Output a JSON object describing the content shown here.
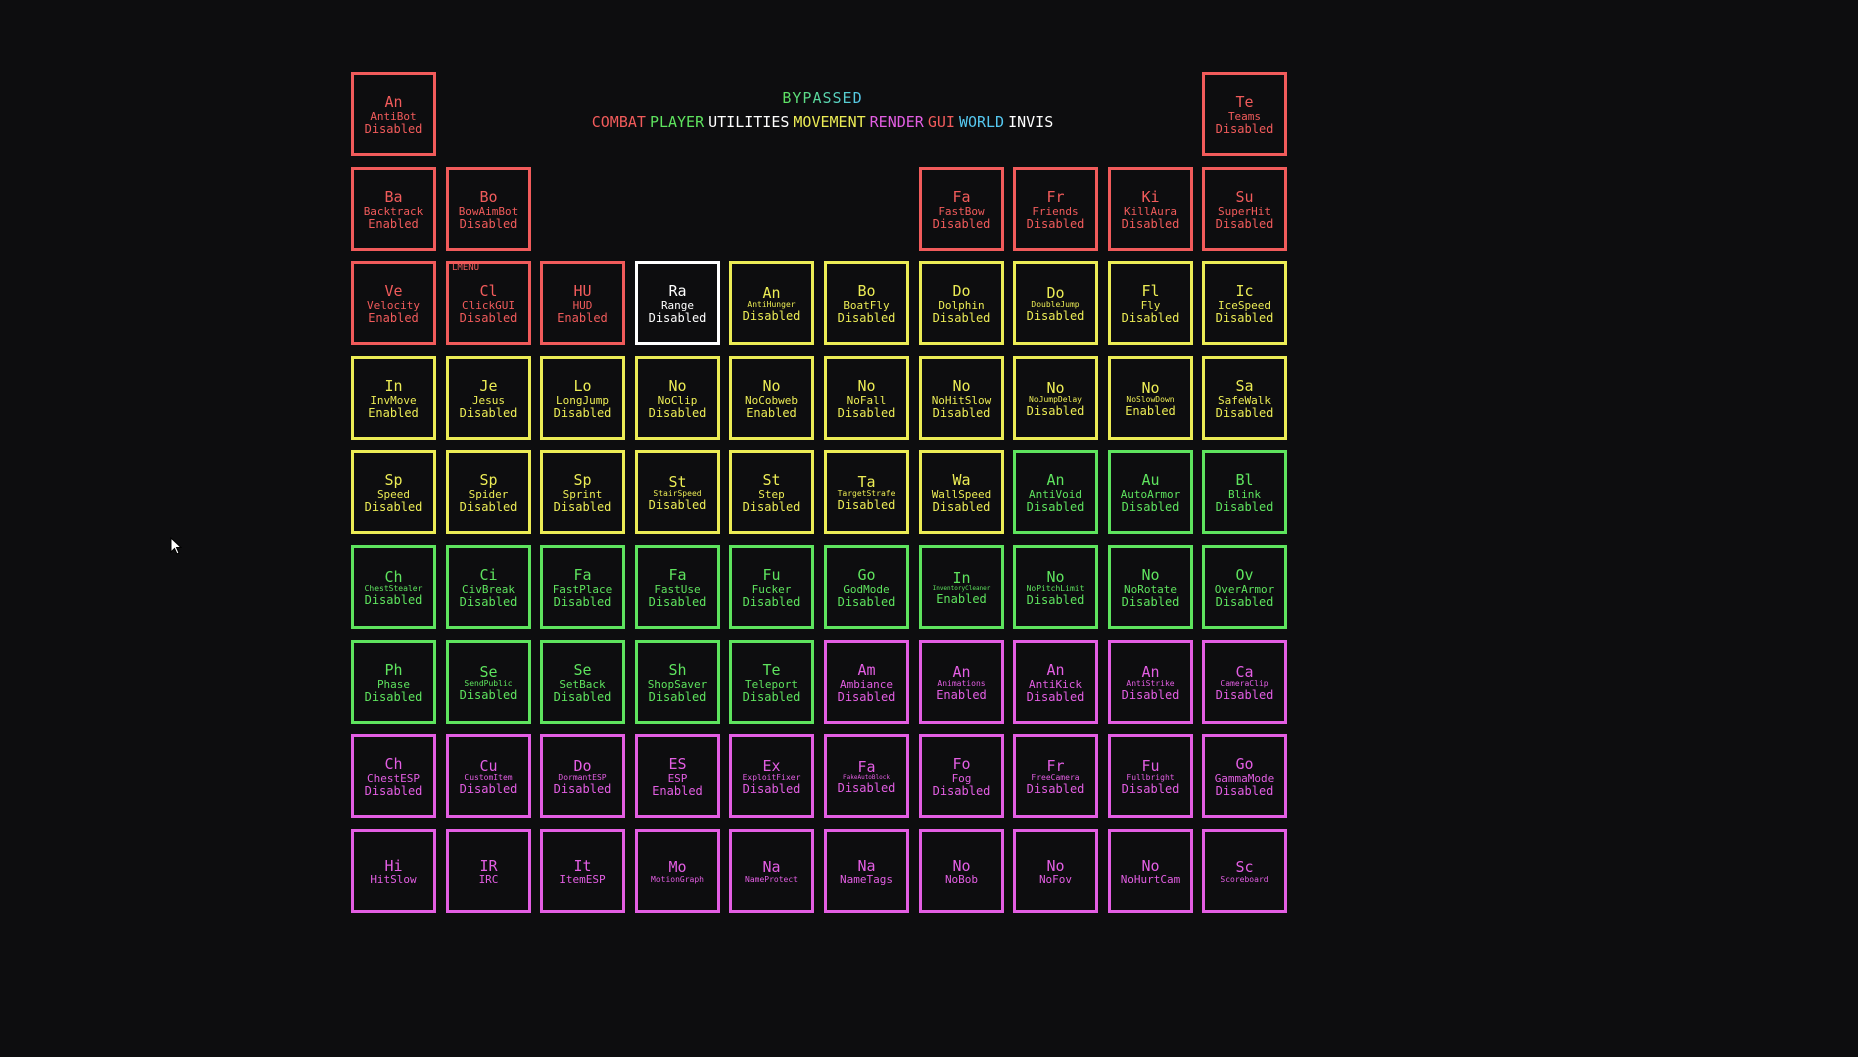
{
  "colors": {
    "combat": "#f15b5b",
    "player": "#5ee35e",
    "utilities": "#ffffff",
    "movement": "#ecec55",
    "render": "#e35ee3",
    "gui": "#f15b5b",
    "world": "#55c8f0",
    "invis": "#ffffff",
    "selected": "#ffffff",
    "bypassed_gradient": [
      "#5ee35e",
      "#55c8f0"
    ]
  },
  "header": {
    "bypassed": "BYPASSED",
    "tabs": [
      {
        "label": "COMBAT",
        "color": "#f15b5b"
      },
      {
        "label": "PLAYER",
        "color": "#5ee35e"
      },
      {
        "label": "UTILITIES",
        "color": "#ffffff"
      },
      {
        "label": "MOVEMENT",
        "color": "#ecec55"
      },
      {
        "label": "RENDER",
        "color": "#e35ee3"
      },
      {
        "label": "GUI",
        "color": "#f15b5b"
      },
      {
        "label": "WORLD",
        "color": "#55c8f0"
      },
      {
        "label": "INVIS",
        "color": "#ffffff"
      }
    ]
  },
  "modules": [
    [
      [
        "An",
        "AntiBot",
        "Disabled",
        "combat"
      ],
      null,
      null,
      null,
      null,
      null,
      null,
      null,
      null,
      [
        "Te",
        "Teams",
        "Disabled",
        "combat"
      ]
    ],
    [
      [
        "Ba",
        "Backtrack",
        "Enabled",
        "combat"
      ],
      [
        "Bo",
        "BowAimBot",
        "Disabled",
        "combat"
      ],
      null,
      null,
      null,
      null,
      [
        "Fa",
        "FastBow",
        "Disabled",
        "combat"
      ],
      [
        "Fr",
        "Friends",
        "Disabled",
        "combat"
      ],
      [
        "Ki",
        "KillAura",
        "Disabled",
        "combat"
      ],
      [
        "Su",
        "SuperHit",
        "Disabled",
        "combat"
      ]
    ],
    [
      [
        "Ve",
        "Velocity",
        "Enabled",
        "combat"
      ],
      [
        "Cl",
        "ClickGUI",
        "Disabled",
        "combat",
        "LMENU"
      ],
      [
        "HU",
        "HUD",
        "Enabled",
        "combat"
      ],
      [
        "Ra",
        "Range",
        "Disabled",
        "selected"
      ],
      [
        "An",
        "AntiHunger",
        "Disabled",
        "movement"
      ],
      [
        "Bo",
        "BoatFly",
        "Disabled",
        "movement"
      ],
      [
        "Do",
        "Dolphin",
        "Disabled",
        "movement"
      ],
      [
        "Do",
        "DoubleJump",
        "Disabled",
        "movement"
      ],
      [
        "Fl",
        "Fly",
        "Disabled",
        "movement"
      ],
      [
        "Ic",
        "IceSpeed",
        "Disabled",
        "movement"
      ]
    ],
    [
      [
        "In",
        "InvMove",
        "Enabled",
        "movement"
      ],
      [
        "Je",
        "Jesus",
        "Disabled",
        "movement"
      ],
      [
        "Lo",
        "LongJump",
        "Disabled",
        "movement"
      ],
      [
        "No",
        "NoClip",
        "Disabled",
        "movement"
      ],
      [
        "No",
        "NoCobweb",
        "Enabled",
        "movement"
      ],
      [
        "No",
        "NoFall",
        "Disabled",
        "movement"
      ],
      [
        "No",
        "NoHitSlow",
        "Disabled",
        "movement"
      ],
      [
        "No",
        "NoJumpDelay",
        "Disabled",
        "movement"
      ],
      [
        "No",
        "NoSlowDown",
        "Enabled",
        "movement"
      ],
      [
        "Sa",
        "SafeWalk",
        "Disabled",
        "movement"
      ]
    ],
    [
      [
        "Sp",
        "Speed",
        "Disabled",
        "movement"
      ],
      [
        "Sp",
        "Spider",
        "Disabled",
        "movement"
      ],
      [
        "Sp",
        "Sprint",
        "Disabled",
        "movement"
      ],
      [
        "St",
        "StairSpeed",
        "Disabled",
        "movement"
      ],
      [
        "St",
        "Step",
        "Disabled",
        "movement"
      ],
      [
        "Ta",
        "TargetStrafe",
        "Disabled",
        "movement"
      ],
      [
        "Wa",
        "WallSpeed",
        "Disabled",
        "movement"
      ],
      [
        "An",
        "AntiVoid",
        "Disabled",
        "player"
      ],
      [
        "Au",
        "AutoArmor",
        "Disabled",
        "player"
      ],
      [
        "Bl",
        "Blink",
        "Disabled",
        "player"
      ]
    ],
    [
      [
        "Ch",
        "ChestStealer",
        "Disabled",
        "player"
      ],
      [
        "Ci",
        "CivBreak",
        "Disabled",
        "player"
      ],
      [
        "Fa",
        "FastPlace",
        "Disabled",
        "player"
      ],
      [
        "Fa",
        "FastUse",
        "Disabled",
        "player"
      ],
      [
        "Fu",
        "Fucker",
        "Disabled",
        "player"
      ],
      [
        "Go",
        "GodMode",
        "Disabled",
        "player"
      ],
      [
        "In",
        "InventoryCleaner",
        "Enabled",
        "player"
      ],
      [
        "No",
        "NoPitchLimit",
        "Disabled",
        "player"
      ],
      [
        "No",
        "NoRotate",
        "Disabled",
        "player"
      ],
      [
        "Ov",
        "OverArmor",
        "Disabled",
        "player"
      ]
    ],
    [
      [
        "Ph",
        "Phase",
        "Disabled",
        "player"
      ],
      [
        "Se",
        "SendPublic",
        "Disabled",
        "player"
      ],
      [
        "Se",
        "SetBack",
        "Disabled",
        "player"
      ],
      [
        "Sh",
        "ShopSaver",
        "Disabled",
        "player"
      ],
      [
        "Te",
        "Teleport",
        "Disabled",
        "player"
      ],
      [
        "Am",
        "Ambiance",
        "Disabled",
        "render"
      ],
      [
        "An",
        "Animations",
        "Enabled",
        "render"
      ],
      [
        "An",
        "AntiKick",
        "Disabled",
        "render"
      ],
      [
        "An",
        "AntiStrike",
        "Disabled",
        "render"
      ],
      [
        "Ca",
        "CameraClip",
        "Disabled",
        "render"
      ]
    ],
    [
      [
        "Ch",
        "ChestESP",
        "Disabled",
        "render"
      ],
      [
        "Cu",
        "CustomItem",
        "Disabled",
        "render"
      ],
      [
        "Do",
        "DormantESP",
        "Disabled",
        "render"
      ],
      [
        "ES",
        "ESP",
        "Enabled",
        "render"
      ],
      [
        "Ex",
        "ExploitFixer",
        "Disabled",
        "render"
      ],
      [
        "Fa",
        "FakeAutoBlock",
        "Disabled",
        "render"
      ],
      [
        "Fo",
        "Fog",
        "Disabled",
        "render"
      ],
      [
        "Fr",
        "FreeCamera",
        "Disabled",
        "render"
      ],
      [
        "Fu",
        "Fullbright",
        "Disabled",
        "render"
      ],
      [
        "Go",
        "GammaMode",
        "Disabled",
        "render"
      ]
    ],
    [
      [
        "Hi",
        "HitSlow",
        "",
        "render"
      ],
      [
        "IR",
        "IRC",
        "",
        "render"
      ],
      [
        "It",
        "ItemESP",
        "",
        "render"
      ],
      [
        "Mo",
        "MotionGraph",
        "",
        "render"
      ],
      [
        "Na",
        "NameProtect",
        "",
        "render"
      ],
      [
        "Na",
        "NameTags",
        "",
        "render"
      ],
      [
        "No",
        "NoBob",
        "",
        "render"
      ],
      [
        "No",
        "NoFov",
        "",
        "render"
      ],
      [
        "No",
        "NoHurtCam",
        "",
        "render"
      ],
      [
        "Sc",
        "Scoreboard",
        "",
        "render"
      ]
    ]
  ]
}
